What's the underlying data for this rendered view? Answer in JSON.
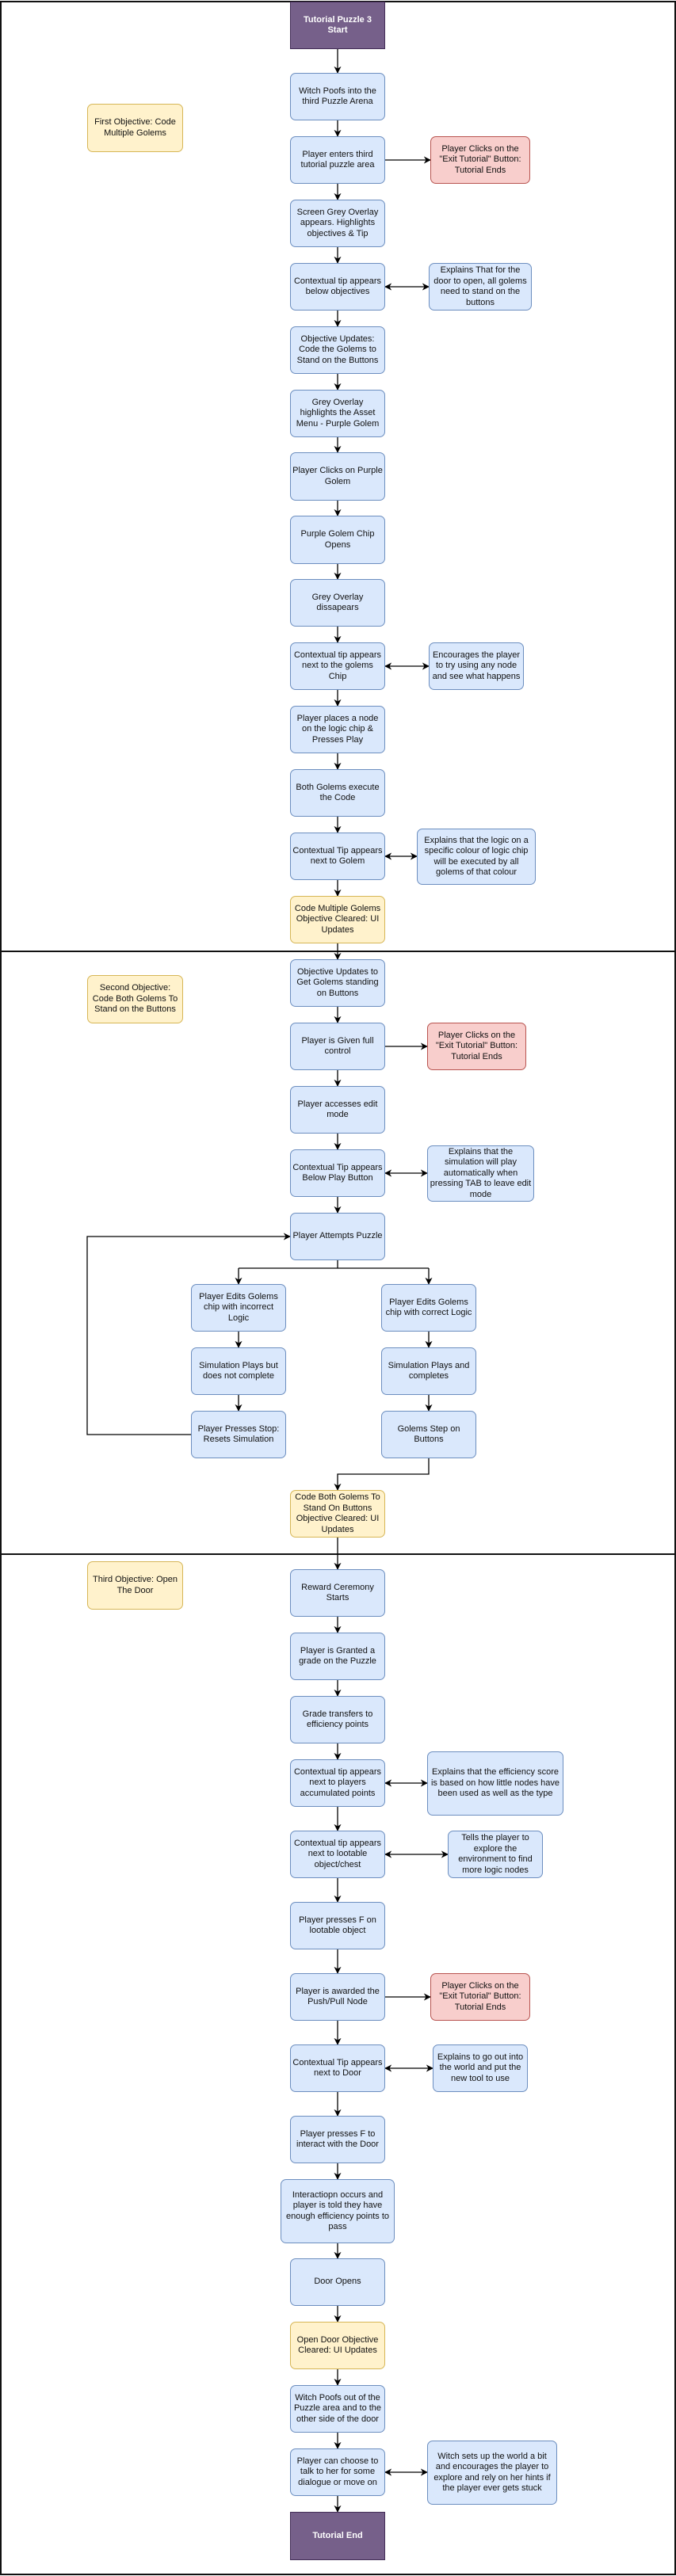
{
  "start": "Tutorial Puzzle 3 Start",
  "end": "Tutorial End",
  "exit_tutorial": "Player Clicks on the \"Exit Tutorial\" Button: Tutorial Ends",
  "colors": {
    "step_fill": "#dae8fc",
    "step_border": "#6c8ebf",
    "exit_fill": "#f8cecc",
    "exit_border": "#b85450",
    "objective_fill": "#fff2cc",
    "objective_border": "#d6b656",
    "terminal_fill": "#76608a"
  },
  "sections": [
    {
      "objective": "First Objective: Code Multiple Golems",
      "steps": [
        "Witch Poofs into the third Puzzle Arena",
        "Player enters third tutorial puzzle area",
        "Screen Grey Overlay appears. Highlights objectives & Tip",
        "Contextual tip appears below objectives",
        "Objective Updates: Code the Golems to Stand on the Buttons",
        "Grey Overlay highlights the Asset Menu - Purple Golem",
        "Player Clicks on Purple Golem",
        "Purple Golem Chip Opens",
        "Grey Overlay dissapears",
        "Contextual tip appears next to the golems Chip",
        "Player places a node on the logic chip & Presses Play",
        "Both Golems execute the Code",
        "Contextual Tip appears next to Golem"
      ],
      "cleared": "Code Multiple Golems Objective Cleared: UI Updates",
      "notes": [
        "Explains That for the door to open, all golems need to stand on the buttons",
        "Encourages the player to try using any node and see what happens",
        "Explains that the logic on a specific colour of logic chip will be executed by all golems of that colour"
      ]
    },
    {
      "objective": "Second Objective: Code Both Golems To Stand on the Buttons",
      "steps": [
        "Objective Updates to Get Golems standing on Buttons",
        "Player is Given full control",
        "Player accesses edit mode",
        "Contextual Tip appears Below Play Button",
        "Player Attempts Puzzle"
      ],
      "incorrect_branch": [
        "Player Edits Golems chip with incorrect Logic",
        "Simulation Plays but does not complete",
        "Player Presses Stop: Resets Simulation"
      ],
      "correct_branch": [
        "Player Edits Golems chip with correct Logic",
        "Simulation Plays and completes",
        "Golems Step on Buttons"
      ],
      "cleared": "Code Both Golems To Stand On Buttons Objective Cleared: UI Updates",
      "notes": [
        "Explains that the simulation will play automatically when pressing TAB to leave edit mode"
      ]
    },
    {
      "objective": "Third Objective: Open The Door",
      "steps": [
        "Reward Ceremony Starts",
        "Player is Granted a grade on the Puzzle",
        "Grade transfers to efficiency points",
        "Contextual tip appears next to players accumulated points",
        "Contextual tip appears next to lootable object/chest",
        "Player presses F on lootable object",
        "Player is awarded the Push/Pull Node",
        "Contextual Tip appears next to Door",
        "Player presses F to interact with the Door",
        "Interactiopn occurs and player is told they have enough efficiency points to pass",
        "Door Opens"
      ],
      "cleared": "Open Door Objective Cleared: UI Updates",
      "after": [
        "Witch Poofs out of the Puzzle area and to the other side of the door",
        "Player can choose to talk to her for some dialogue or move on"
      ],
      "notes": [
        "Explains that the efficiency score is based on how little nodes have been used as well as the type",
        "Tells the player to explore the environment to find more logic nodes",
        "Explains to go out into the world and put the new tool to use",
        "Witch sets up the world a bit and encourages the player to explore and rely on her hints if the player ever gets stuck"
      ]
    }
  ]
}
